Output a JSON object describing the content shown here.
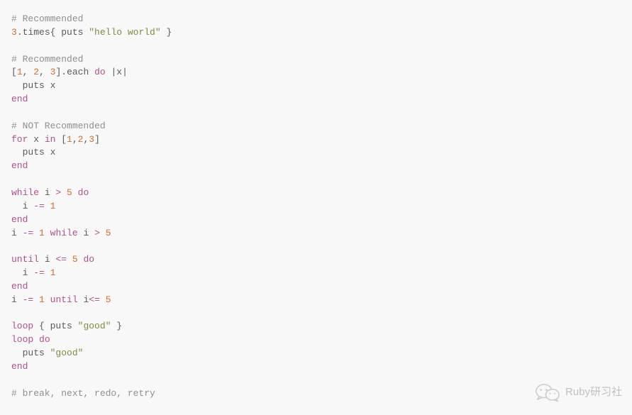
{
  "code": {
    "lines": [
      [
        {
          "cls": "c",
          "text": "# Recommended"
        }
      ],
      [
        {
          "cls": "n",
          "text": "3"
        },
        {
          "cls": "t",
          "text": ".times{ puts "
        },
        {
          "cls": "s",
          "text": "\"hello world\""
        },
        {
          "cls": "t",
          "text": " }"
        }
      ],
      [],
      [
        {
          "cls": "c",
          "text": "# Recommended"
        }
      ],
      [
        {
          "cls": "t",
          "text": "["
        },
        {
          "cls": "n",
          "text": "1"
        },
        {
          "cls": "t",
          "text": ", "
        },
        {
          "cls": "n",
          "text": "2"
        },
        {
          "cls": "t",
          "text": ", "
        },
        {
          "cls": "n",
          "text": "3"
        },
        {
          "cls": "t",
          "text": "].each "
        },
        {
          "cls": "k",
          "text": "do"
        },
        {
          "cls": "t",
          "text": " |x|"
        }
      ],
      [
        {
          "cls": "t",
          "text": "  puts x"
        }
      ],
      [
        {
          "cls": "k",
          "text": "end"
        }
      ],
      [],
      [
        {
          "cls": "c",
          "text": "# NOT Recommended"
        }
      ],
      [
        {
          "cls": "k",
          "text": "for"
        },
        {
          "cls": "t",
          "text": " x "
        },
        {
          "cls": "k",
          "text": "in"
        },
        {
          "cls": "t",
          "text": " ["
        },
        {
          "cls": "n",
          "text": "1"
        },
        {
          "cls": "t",
          "text": ","
        },
        {
          "cls": "n",
          "text": "2"
        },
        {
          "cls": "t",
          "text": ","
        },
        {
          "cls": "n",
          "text": "3"
        },
        {
          "cls": "t",
          "text": "]"
        }
      ],
      [
        {
          "cls": "t",
          "text": "  puts x"
        }
      ],
      [
        {
          "cls": "k",
          "text": "end"
        }
      ],
      [],
      [
        {
          "cls": "k",
          "text": "while"
        },
        {
          "cls": "t",
          "text": " i "
        },
        {
          "cls": "k",
          "text": ">"
        },
        {
          "cls": "t",
          "text": " "
        },
        {
          "cls": "n",
          "text": "5"
        },
        {
          "cls": "t",
          "text": " "
        },
        {
          "cls": "k",
          "text": "do"
        }
      ],
      [
        {
          "cls": "t",
          "text": "  i "
        },
        {
          "cls": "k",
          "text": "-="
        },
        {
          "cls": "t",
          "text": " "
        },
        {
          "cls": "n",
          "text": "1"
        }
      ],
      [
        {
          "cls": "k",
          "text": "end"
        }
      ],
      [
        {
          "cls": "t",
          "text": "i "
        },
        {
          "cls": "k",
          "text": "-="
        },
        {
          "cls": "t",
          "text": " "
        },
        {
          "cls": "n",
          "text": "1"
        },
        {
          "cls": "t",
          "text": " "
        },
        {
          "cls": "k",
          "text": "while"
        },
        {
          "cls": "t",
          "text": " i "
        },
        {
          "cls": "k",
          "text": ">"
        },
        {
          "cls": "t",
          "text": " "
        },
        {
          "cls": "n",
          "text": "5"
        }
      ],
      [],
      [
        {
          "cls": "k",
          "text": "until"
        },
        {
          "cls": "t",
          "text": " i "
        },
        {
          "cls": "k",
          "text": "<="
        },
        {
          "cls": "t",
          "text": " "
        },
        {
          "cls": "n",
          "text": "5"
        },
        {
          "cls": "t",
          "text": " "
        },
        {
          "cls": "k",
          "text": "do"
        }
      ],
      [
        {
          "cls": "t",
          "text": "  i "
        },
        {
          "cls": "k",
          "text": "-="
        },
        {
          "cls": "t",
          "text": " "
        },
        {
          "cls": "n",
          "text": "1"
        }
      ],
      [
        {
          "cls": "k",
          "text": "end"
        }
      ],
      [
        {
          "cls": "t",
          "text": "i "
        },
        {
          "cls": "k",
          "text": "-="
        },
        {
          "cls": "t",
          "text": " "
        },
        {
          "cls": "n",
          "text": "1"
        },
        {
          "cls": "t",
          "text": " "
        },
        {
          "cls": "k",
          "text": "until"
        },
        {
          "cls": "t",
          "text": " i"
        },
        {
          "cls": "k",
          "text": "<="
        },
        {
          "cls": "t",
          "text": " "
        },
        {
          "cls": "n",
          "text": "5"
        }
      ],
      [],
      [
        {
          "cls": "k",
          "text": "loop"
        },
        {
          "cls": "t",
          "text": " { puts "
        },
        {
          "cls": "s",
          "text": "\"good\""
        },
        {
          "cls": "t",
          "text": " }"
        }
      ],
      [
        {
          "cls": "k",
          "text": "loop"
        },
        {
          "cls": "t",
          "text": " "
        },
        {
          "cls": "k",
          "text": "do"
        }
      ],
      [
        {
          "cls": "t",
          "text": "  puts "
        },
        {
          "cls": "s",
          "text": "\"good\""
        }
      ],
      [
        {
          "cls": "k",
          "text": "end"
        }
      ],
      [],
      [
        {
          "cls": "c",
          "text": "# break, next, redo, retry"
        }
      ]
    ]
  },
  "watermark": {
    "text": "Ruby研习社"
  }
}
